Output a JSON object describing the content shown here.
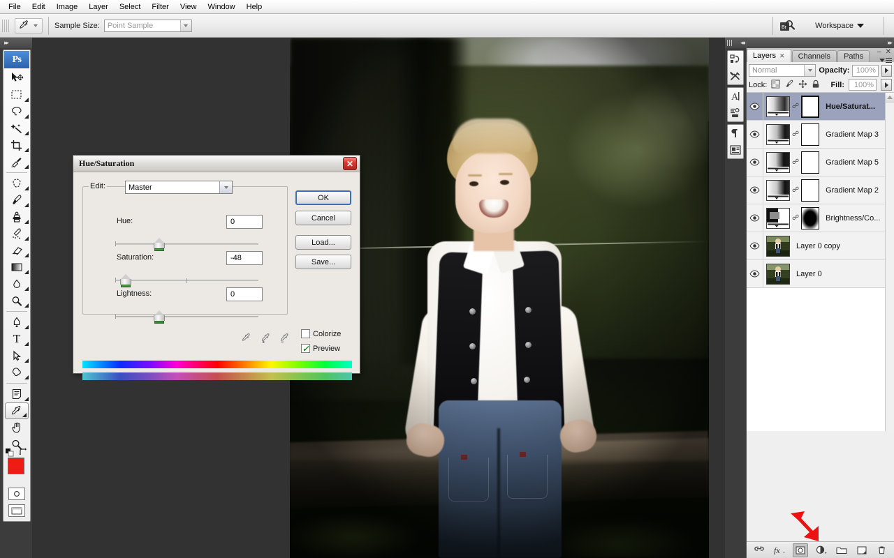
{
  "app": {
    "name": "Adobe Photoshop",
    "logo_text": "Ps"
  },
  "menubar": {
    "items": [
      {
        "label": "File"
      },
      {
        "label": "Edit"
      },
      {
        "label": "Image"
      },
      {
        "label": "Layer"
      },
      {
        "label": "Select"
      },
      {
        "label": "Filter"
      },
      {
        "label": "View"
      },
      {
        "label": "Window"
      },
      {
        "label": "Help"
      }
    ]
  },
  "options_bar": {
    "active_tool": "eyedropper-tool",
    "sample_size_label": "Sample Size:",
    "sample_size_value": "Point Sample",
    "bridge_button_label": "Br",
    "workspace_label": "Workspace"
  },
  "toolbox": {
    "tools": [
      {
        "name": "move-tool",
        "icon": "arrow-move"
      },
      {
        "name": "rectangular-marquee-tool",
        "icon": "marquee"
      },
      {
        "name": "lasso-tool",
        "icon": "lasso"
      },
      {
        "name": "magic-wand-tool",
        "icon": "wand"
      },
      {
        "name": "crop-tool",
        "icon": "crop"
      },
      {
        "name": "slice-tool",
        "icon": "slice"
      },
      {
        "name": "healing-brush-tool",
        "icon": "healing"
      },
      {
        "name": "brush-tool",
        "icon": "brush"
      },
      {
        "name": "clone-stamp-tool",
        "icon": "stamp"
      },
      {
        "name": "history-brush-tool",
        "icon": "history-brush"
      },
      {
        "name": "eraser-tool",
        "icon": "eraser"
      },
      {
        "name": "gradient-tool",
        "icon": "gradient"
      },
      {
        "name": "blur-tool",
        "icon": "blur-drop"
      },
      {
        "name": "dodge-tool",
        "icon": "dodge"
      },
      {
        "name": "pen-tool",
        "icon": "pen"
      },
      {
        "name": "type-tool",
        "icon": "type-T"
      },
      {
        "name": "path-selection-tool",
        "icon": "path-arrow"
      },
      {
        "name": "custom-shape-tool",
        "icon": "shape-blob"
      },
      {
        "name": "notes-tool",
        "icon": "note"
      },
      {
        "name": "eyedropper-tool",
        "icon": "eyedropper",
        "selected": true
      },
      {
        "name": "hand-tool",
        "icon": "hand"
      },
      {
        "name": "zoom-tool",
        "icon": "magnifier"
      }
    ],
    "foreground_color": "#ee1c15",
    "background_color": "#ffffff",
    "quick_mask_label": "Quick Mask",
    "screen_mode_label": "Screen Mode"
  },
  "dialog": {
    "title": "Hue/Saturation",
    "close_label": "✕",
    "edit_label": "Edit:",
    "edit_value": "Master",
    "sliders": [
      {
        "label": "Hue:",
        "value": "0",
        "thumb_pct": 50
      },
      {
        "label": "Saturation:",
        "value": "-48",
        "thumb_pct": 26
      },
      {
        "label": "Lightness:",
        "value": "0",
        "thumb_pct": 50
      }
    ],
    "buttons": [
      {
        "label": "OK",
        "name": "ok-button",
        "default": true
      },
      {
        "label": "Cancel",
        "name": "cancel-button",
        "default": false
      },
      {
        "label": "Load...",
        "name": "load-button",
        "default": false
      },
      {
        "label": "Save...",
        "name": "save-button",
        "default": false
      }
    ],
    "checkboxes": [
      {
        "label": "Colorize",
        "checked": false
      },
      {
        "label": "Preview",
        "checked": true
      }
    ],
    "eyedroppers": [
      "eyedropper-sample",
      "eyedropper-add",
      "eyedropper-subtract"
    ],
    "gradient_top_stops": [
      "#00e5ff",
      "#0b2bff",
      "#7a0bff",
      "#ff00d4",
      "#ff0000",
      "#ff7a00",
      "#fff700",
      "#7dff00",
      "#00ff3c",
      "#00ffc8"
    ],
    "gradient_bottom_stops": [
      "#4fc4cf",
      "#3a4fc0",
      "#7a4fc0",
      "#c44fb8",
      "#c44f4f",
      "#c4864f",
      "#c4bf4f",
      "#86c44f",
      "#4fc45f",
      "#4fc4ae"
    ]
  },
  "dock_strip": {
    "items": [
      {
        "name": "history-panel-icon",
        "glyph": "↻"
      },
      {
        "name": "tool-presets-panel-icon",
        "glyph": "⚒"
      },
      {
        "name": "character-panel-icon",
        "glyph": "A"
      },
      {
        "name": "brushes-panel-icon",
        "glyph": "⁂"
      },
      {
        "name": "paragraph-panel-icon",
        "glyph": "¶"
      },
      {
        "name": "info-panel-icon",
        "glyph": "☰"
      }
    ]
  },
  "layers_panel": {
    "tabs": [
      {
        "label": "Layers",
        "active": true,
        "closable": true
      },
      {
        "label": "Channels",
        "active": false,
        "closable": false
      },
      {
        "label": "Paths",
        "active": false,
        "closable": false
      }
    ],
    "blend_mode": "Normal",
    "opacity_label": "Opacity:",
    "opacity_value": "100%",
    "lock_label": "Lock:",
    "fill_label": "Fill:",
    "fill_value": "100%",
    "lock_icons": [
      "lock-transparent-pixels-icon",
      "lock-image-pixels-icon",
      "lock-position-icon",
      "lock-all-icon"
    ],
    "layers": [
      {
        "name": "Hue/Saturat...",
        "selected": true,
        "type": "adjustment",
        "thumb": "huesat-gradient",
        "has_mask": true,
        "mask": "white"
      },
      {
        "name": "Gradient Map 3",
        "selected": false,
        "type": "adjustment",
        "thumb": "gradient-map",
        "has_mask": true,
        "mask": "white"
      },
      {
        "name": "Gradient Map 5",
        "selected": false,
        "type": "adjustment",
        "thumb": "gradient-map",
        "has_mask": true,
        "mask": "white"
      },
      {
        "name": "Gradient Map 2",
        "selected": false,
        "type": "adjustment",
        "thumb": "gradient-map",
        "has_mask": true,
        "mask": "white"
      },
      {
        "name": "Brightness/Co...",
        "selected": false,
        "type": "adjustment",
        "thumb": "brightness-contrast",
        "has_mask": true,
        "mask": "black-blob"
      },
      {
        "name": "Layer 0 copy",
        "selected": false,
        "type": "pixel",
        "thumb": "photo",
        "has_mask": false
      },
      {
        "name": "Layer 0",
        "selected": false,
        "type": "pixel",
        "thumb": "photo",
        "has_mask": false
      }
    ],
    "footer_buttons": [
      {
        "name": "link-layers-button",
        "glyph": "∞"
      },
      {
        "name": "layer-style-button",
        "glyph": "fx"
      },
      {
        "name": "add-layer-mask-button",
        "glyph": "●"
      },
      {
        "name": "new-adjustment-layer-button",
        "glyph": "◑"
      },
      {
        "name": "new-group-button",
        "glyph": "▭"
      },
      {
        "name": "new-layer-button",
        "glyph": "❐"
      },
      {
        "name": "delete-layer-button",
        "glyph": "⌧"
      }
    ]
  },
  "annotation": {
    "arrow_color": "#ee1111",
    "arrow_points_to": "new-adjustment-layer-button"
  }
}
